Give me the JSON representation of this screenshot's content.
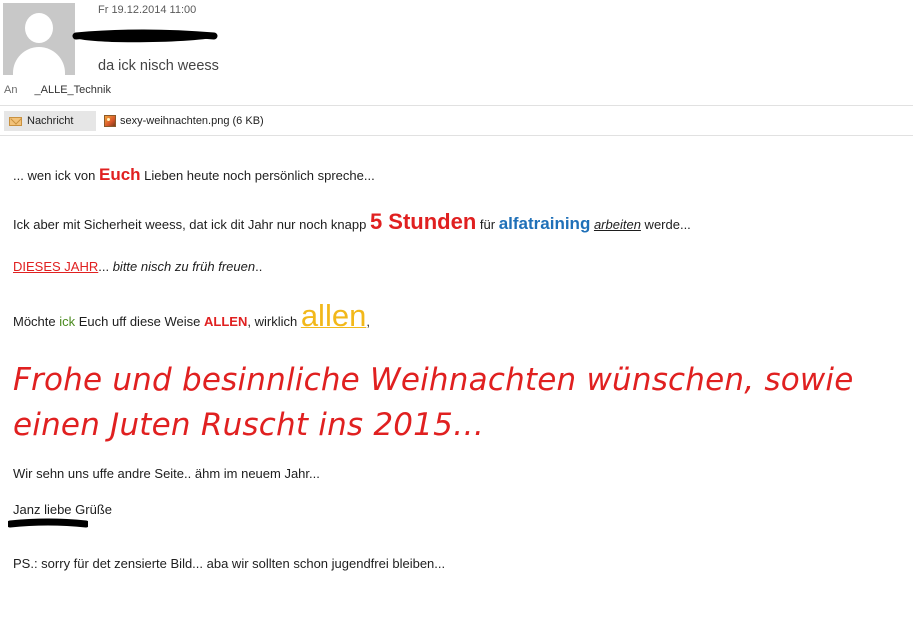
{
  "header": {
    "date": "Fr 19.12.2014 11:00",
    "subject": "da ick nisch weess",
    "to_label": "An",
    "recipient": "_ALLE_Technik"
  },
  "tabs": {
    "message_label": "Nachricht",
    "attachment_label": "sexy-weihnachten.png (6 KB)"
  },
  "body": {
    "line1": {
      "before": "... wen ick von ",
      "euch": "Euch",
      "after": " Lieben heute noch persönlich spreche..."
    },
    "line2": {
      "before": "Ick aber mit Sicherheit weess, dat ick dit Jahr nur noch knapp ",
      "stunden": "5 Stunden",
      "fuer": " für ",
      "alfa": "alfatraining",
      "space": " ",
      "arbeiten": "arbeiten",
      "after": " werde..."
    },
    "line3": {
      "dieses": "DIESES JAHR",
      "dots": "...",
      "italic": " bitte nisch zu früh freuen",
      "end": ".."
    },
    "line4": {
      "before": "Möchte ",
      "ick": "ick",
      "middle": " Euch uff diese Weise ",
      "allen_caps": "ALLEN",
      "wirklich": ", wirklich ",
      "allen_big": "allen",
      "comma": ","
    },
    "greeting": "Frohe und besinnliche Weihnachten wünschen, sowie einen Juten Ruscht ins 2015…",
    "line5": "Wir sehn uns uffe andre Seite.. ähm im neuem Jahr...",
    "line6": "Janz liebe Grüße",
    "line7": "PS.: sorry für det zensierte Bild... aba wir sollten schon jugendfrei bleiben..."
  },
  "colors": {
    "accent_red": "#e02020",
    "alfa_blue": "#1f70b8",
    "gold": "#f2b81a",
    "green": "#4a8a1e"
  }
}
